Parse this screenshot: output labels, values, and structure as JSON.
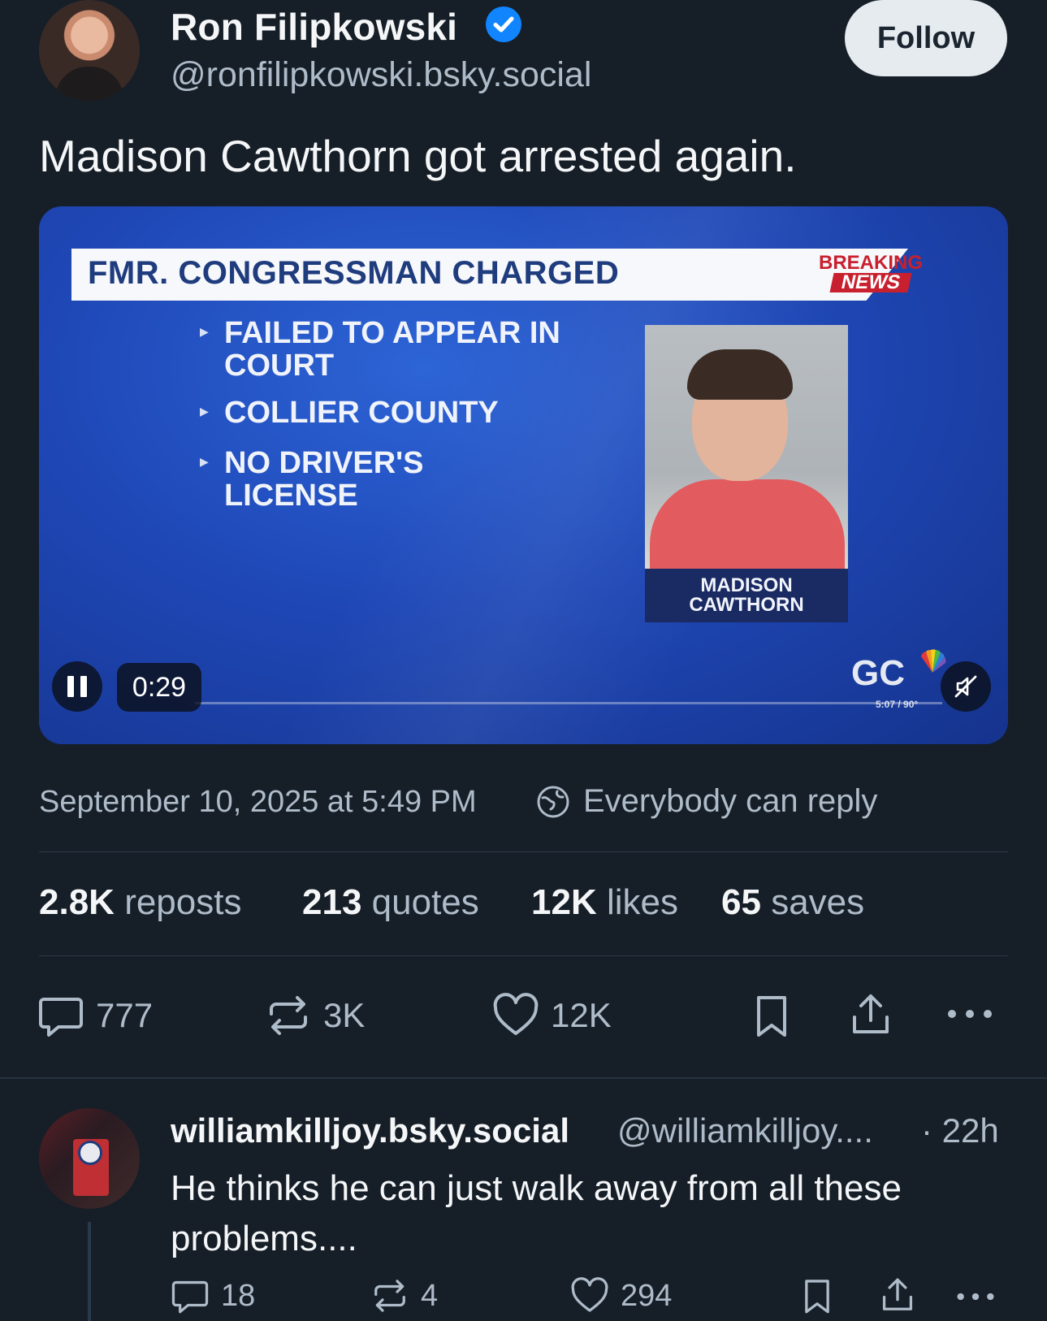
{
  "post": {
    "author_name": "Ron Filipkowski",
    "author_handle": "@ronfilipkowski.bsky.social",
    "follow_label": "Follow",
    "text": "Madison Cawthorn got arrested again.",
    "timestamp": "September 10, 2025 at 5:49 PM",
    "reply_setting": "Everybody can reply"
  },
  "video": {
    "banner": "FMR. CONGRESSMAN CHARGED",
    "breaking_line1": "BREAKING",
    "breaking_line2": "NEWS",
    "bullets": [
      {
        "line1": "FAILED TO APPEAR IN",
        "line2": "COURT"
      },
      {
        "line1": "COLLIER COUNTY",
        "line2": ""
      },
      {
        "line1": "NO DRIVER'S",
        "line2": "LICENSE"
      }
    ],
    "nameplate_line1": "MADISON",
    "nameplate_line2": "CAWTHORN",
    "station_logo": "GC",
    "small_time": "5:07 / 90°",
    "elapsed": "0:29"
  },
  "stats": {
    "reposts_n": "2.8K",
    "reposts_l": "reposts",
    "quotes_n": "213",
    "quotes_l": "quotes",
    "likes_n": "12K",
    "likes_l": "likes",
    "saves_n": "65",
    "saves_l": "saves"
  },
  "actions": {
    "replies": "777",
    "reposts": "3K",
    "likes": "12K"
  },
  "reply": {
    "author_name": "williamkilljoy.bsky.social",
    "author_handle": "@williamkilljoy....",
    "time": "· 22h",
    "text": "He thinks he can just walk away from all these problems....",
    "replies": "18",
    "reposts": "4",
    "likes": "294"
  },
  "icons": [
    "verified-badge-icon",
    "pause-icon",
    "mute-icon",
    "globe-icon",
    "comment-icon",
    "repost-icon",
    "heart-icon",
    "bookmark-icon",
    "share-icon",
    "more-icon"
  ],
  "colors": {
    "background": "#161e27",
    "accent": "#1185fe",
    "muted_text": "#aebbc9"
  }
}
